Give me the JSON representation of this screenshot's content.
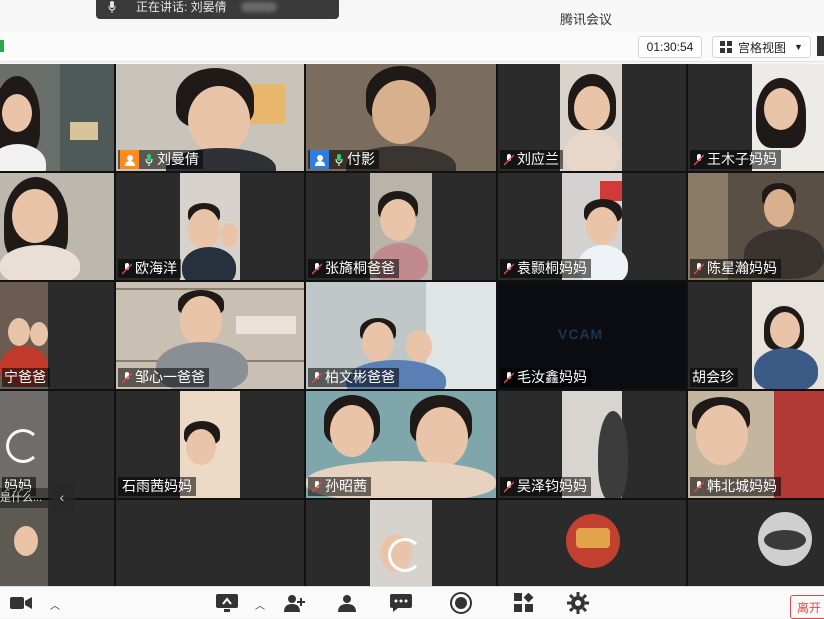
{
  "window": {
    "title": "腾讯会议"
  },
  "speaker": {
    "label": "正在讲话: 刘晏倩"
  },
  "toolbar": {
    "timer": "01:30:54",
    "view_label": "宫格视图"
  },
  "participants": [
    {
      "name": "",
      "tile": "r1c1"
    },
    {
      "name": "刘曼倩",
      "role": "host",
      "tile": "r1c2"
    },
    {
      "name": "付影",
      "role": "cohost",
      "tile": "r1c3"
    },
    {
      "name": "刘应兰",
      "tile": "r1c4"
    },
    {
      "name": "王木子妈妈",
      "tile": "r1c5"
    },
    {
      "name": "",
      "tile": "r2c1"
    },
    {
      "name": "欧海洋",
      "tile": "r2c2"
    },
    {
      "name": "张旖桐爸爸",
      "tile": "r2c3"
    },
    {
      "name": "袁颢桐妈妈",
      "tile": "r2c4"
    },
    {
      "name": "陈星瀚妈妈",
      "tile": "r2c5"
    },
    {
      "name": "宁爸爸",
      "tile": "r3c1"
    },
    {
      "name": "邹心一爸爸",
      "tile": "r3c2"
    },
    {
      "name": "柏文彬爸爸",
      "tile": "r3c3"
    },
    {
      "name": "毛汝鑫妈妈",
      "tile": "r3c4"
    },
    {
      "name": "胡会珍",
      "tile": "r3c5"
    },
    {
      "name": "妈妈",
      "tile": "r4c1"
    },
    {
      "name": "石雨茜妈妈",
      "tile": "r4c2"
    },
    {
      "name": "孙昭茜",
      "tile": "r4c3"
    },
    {
      "name": "吴泽钧妈妈",
      "tile": "r4c4"
    },
    {
      "name": "韩北城妈妈",
      "tile": "r4c5"
    }
  ],
  "vcam_text": "VCAM",
  "chat_preview": "是什么...",
  "bottombar": {
    "leave_label": "离开"
  },
  "colors": {
    "host": "#ff8c1a",
    "cohost": "#2f7de1",
    "leave": "#e24a4a"
  }
}
